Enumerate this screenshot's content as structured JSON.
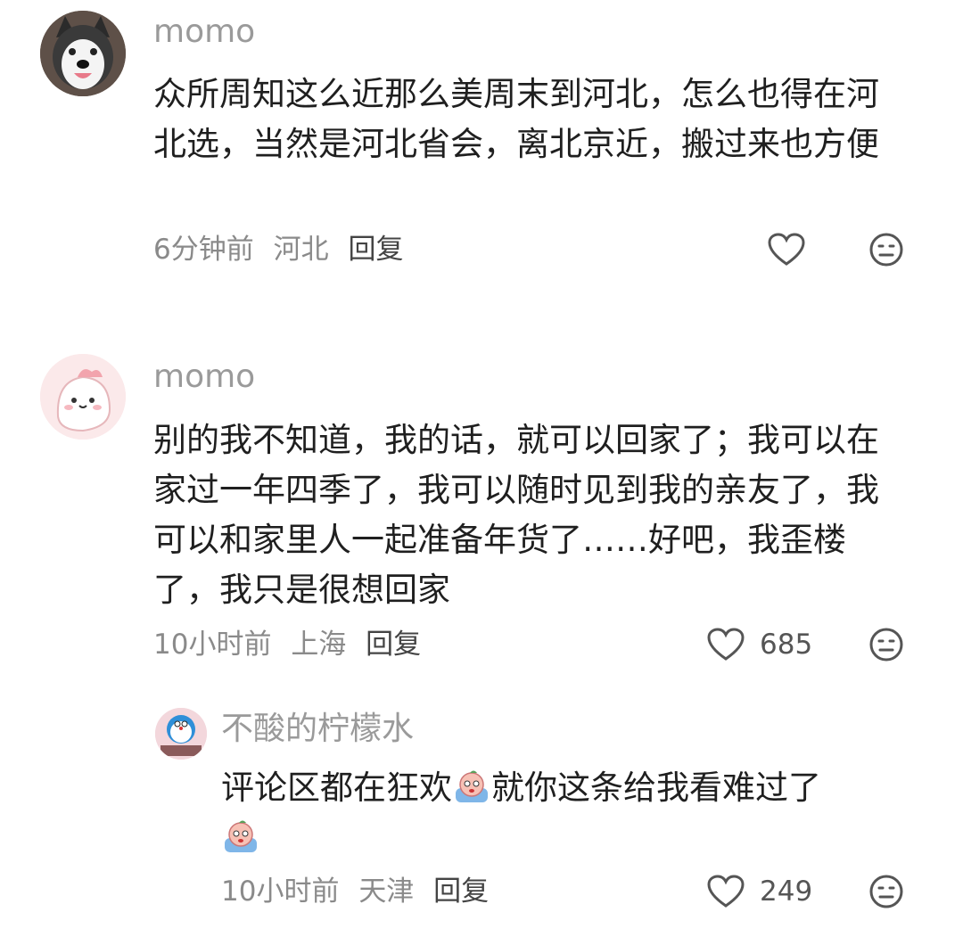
{
  "comments": [
    {
      "username": "momo",
      "text": "众所周知这么近那么美周末到河北，怎么也得在河北选，当然是河北省会，离北京近，搬过来也方便",
      "time": "6分钟前",
      "location": "河北",
      "reply_label": "回复",
      "likes": "",
      "avatar_icon": "husky-dog-avatar"
    },
    {
      "username": "momo",
      "text": "别的我不知道，我的话，就可以回家了；我可以在家过一年四季了，我可以随时见到我的亲友了，我可以和家里人一起准备年货了……好吧，我歪楼了，我只是很想回家",
      "time": "10小时前",
      "location": "上海",
      "reply_label": "回复",
      "likes": "685",
      "avatar_icon": "pink-blob-avatar"
    },
    {
      "username": "不酸的柠檬水",
      "text_part1": "评论区都在狂欢",
      "text_part2": "就你这条给我看难过了",
      "time": "10小时前",
      "location": "天津",
      "reply_label": "回复",
      "likes": "249",
      "avatar_icon": "doraemon-avatar"
    }
  ],
  "colors": {
    "username": "#9a9a9a",
    "text": "#1f1f1f",
    "meta": "#8a8a8a"
  }
}
